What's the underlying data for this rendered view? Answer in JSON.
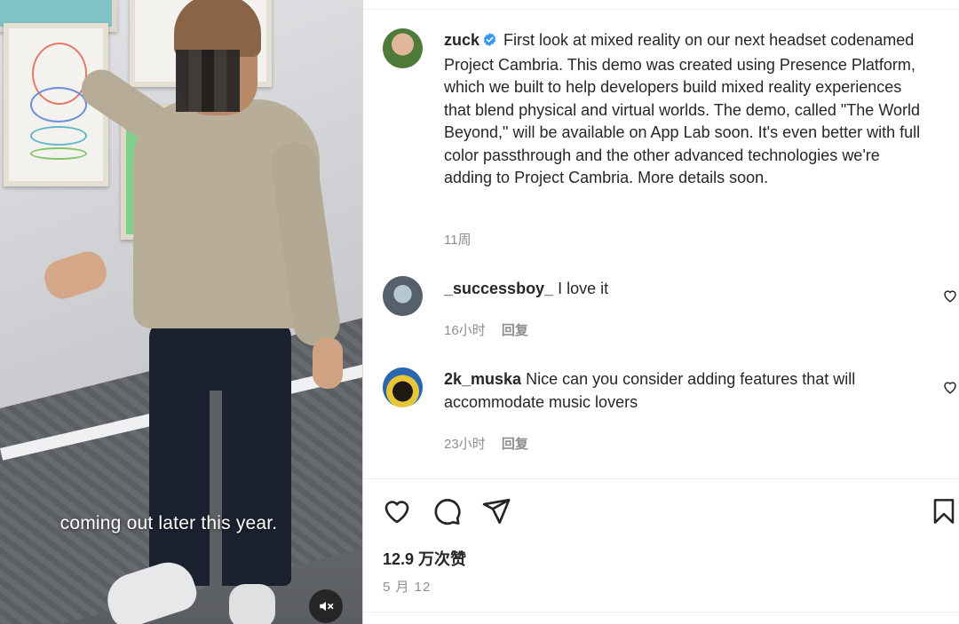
{
  "video": {
    "subtitle": "coming out later this year.",
    "mute_icon": "muted-speaker-icon"
  },
  "post": {
    "author": {
      "username": "zuck",
      "verified": true,
      "avatar_icon": "avatar"
    },
    "caption": "First look at mixed reality on our next headset codenamed Project Cambria. This demo was created using Presence Platform, which we built to help developers build mixed reality experiences that blend physical and virtual worlds. The demo, called \"The World Beyond,\" will be available on App Lab soon. It's even better with full color passthrough and the other advanced technologies we're adding to Project Cambria. More details soon.",
    "age": "11周"
  },
  "comments": [
    {
      "username": "_successboy_",
      "text": "I love it",
      "age": "16小时",
      "reply_label": "回复"
    },
    {
      "username": "2k_muska",
      "text": "Nice can you consider adding features that will accommodate music lovers",
      "age": "23小时",
      "reply_label": "回复"
    }
  ],
  "actions": {
    "like_icon": "heart-icon",
    "comment_icon": "comment-icon",
    "share_icon": "send-icon",
    "save_icon": "bookmark-icon"
  },
  "stats": {
    "likes": "12.9 万次赞",
    "date": "5 月 12"
  },
  "colors": {
    "verified": "#3897f0",
    "text": "#262626",
    "secondary": "#8e8e8e"
  }
}
